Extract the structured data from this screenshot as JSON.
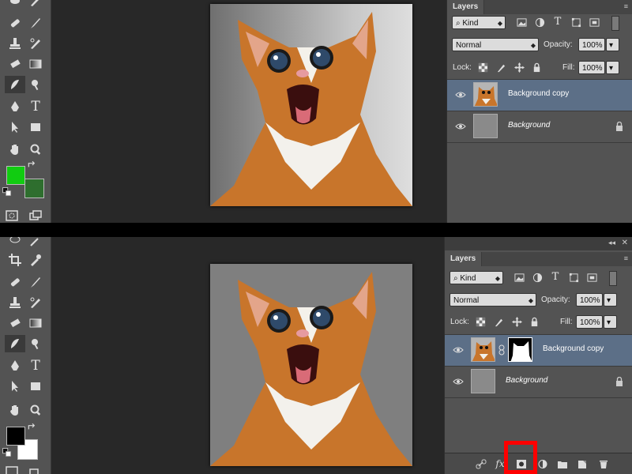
{
  "top": {
    "layers_panel": {
      "tab_label": "Layers",
      "filter_kind": "Kind",
      "blend_mode": "Normal",
      "opacity_label": "Opacity:",
      "opacity_value": "100%",
      "lock_label": "Lock:",
      "fill_label": "Fill:",
      "fill_value": "100%",
      "layers": [
        {
          "name": "Background copy",
          "selected": true,
          "italic": false
        },
        {
          "name": "Background",
          "selected": false,
          "italic": true,
          "locked": true
        }
      ]
    },
    "colors": {
      "foreground": "#11cc11",
      "background": "#2e6e2e"
    }
  },
  "bottom": {
    "layers_panel": {
      "tab_label": "Layers",
      "filter_kind": "Kind",
      "blend_mode": "Normal",
      "opacity_label": "Opacity:",
      "opacity_value": "100%",
      "lock_label": "Lock:",
      "fill_label": "Fill:",
      "fill_value": "100%",
      "layers": [
        {
          "name": "Background copy",
          "selected": true,
          "italic": false,
          "has_mask": true
        },
        {
          "name": "Background",
          "selected": false,
          "italic": true,
          "locked": true
        }
      ],
      "bottom_icons": [
        "link-icon",
        "fx-icon",
        "add-mask-icon",
        "adjustment-icon",
        "group-folder-icon",
        "new-layer-icon",
        "trash-icon"
      ],
      "fx_label": "fx",
      "highlighted_icon": "add-mask-icon"
    },
    "colors": {
      "foreground": "#000000",
      "background": "#ffffff"
    }
  },
  "theme": {
    "selection": "#5c6f87",
    "highlight": "#ff0000"
  }
}
